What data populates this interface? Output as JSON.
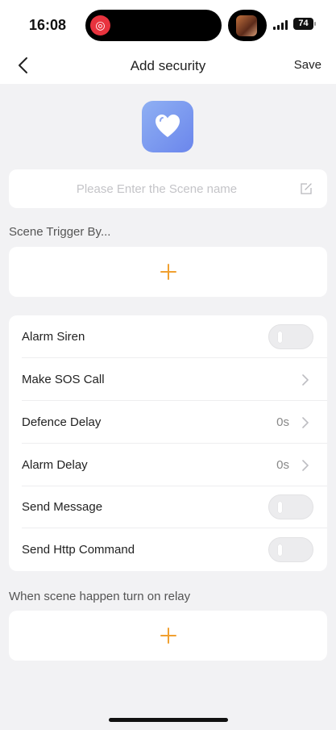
{
  "status_bar": {
    "time": "16:08",
    "battery": "74"
  },
  "nav": {
    "title": "Add security",
    "save_label": "Save",
    "back_icon": "chevron-left-icon"
  },
  "scene_icon": {
    "icon": "heart-icon",
    "color": "#7b96ee"
  },
  "scene_name": {
    "value": "",
    "placeholder": "Please Enter the Scene name",
    "edit_icon": "edit-icon"
  },
  "trigger": {
    "label": "Scene Trigger By...",
    "add_icon": "plus-icon"
  },
  "settings": {
    "rows": [
      {
        "label": "Alarm Siren",
        "type": "toggle",
        "on": false
      },
      {
        "label": "Make SOS Call",
        "type": "link"
      },
      {
        "label": "Defence Delay",
        "type": "link",
        "value": "0s"
      },
      {
        "label": "Alarm Delay",
        "type": "link",
        "value": "0s"
      },
      {
        "label": "Send Message",
        "type": "toggle",
        "on": false
      },
      {
        "label": "Send Http Command",
        "type": "toggle",
        "on": false
      }
    ]
  },
  "relay": {
    "label": "When scene happen turn on relay",
    "add_icon": "plus-icon"
  },
  "colors": {
    "accent": "#f0a030",
    "background": "#f2f2f4"
  }
}
